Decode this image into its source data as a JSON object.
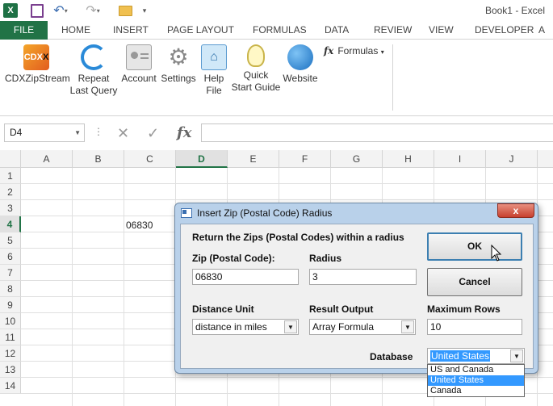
{
  "app": {
    "logo_letter": "X",
    "window_title": "Book1 - Excel"
  },
  "tabs": [
    "FILE",
    "HOME",
    "INSERT",
    "PAGE LAYOUT",
    "FORMULAS",
    "DATA",
    "REVIEW",
    "VIEW",
    "DEVELOPER",
    "A"
  ],
  "ribbon": {
    "buttons": [
      {
        "icon": "cdx-logo-icon",
        "label1": "CDXZipStream",
        "label2": ""
      },
      {
        "icon": "repeat-icon",
        "label1": "Repeat",
        "label2": "Last Query"
      },
      {
        "icon": "account-icon",
        "label1": "Account",
        "label2": ""
      },
      {
        "icon": "settings-icon",
        "label1": "Settings",
        "label2": ""
      },
      {
        "icon": "help-file-icon",
        "label1": "Help",
        "label2": "File"
      },
      {
        "icon": "lightbulb-icon",
        "label1": "Quick",
        "label2": "Start Guide"
      },
      {
        "icon": "globe-icon",
        "label1": "Website",
        "label2": ""
      }
    ],
    "cdx_logo_text": "CDX",
    "formulas_dropdown": "Formulas"
  },
  "formula_bar": {
    "name_box": "D4",
    "content": ""
  },
  "grid": {
    "columns": [
      "A",
      "B",
      "C",
      "D",
      "E",
      "F",
      "G",
      "H",
      "I",
      "J"
    ],
    "active_column": "D",
    "rows": [
      "1",
      "2",
      "3",
      "4",
      "5",
      "6",
      "7",
      "8",
      "9",
      "10",
      "11",
      "12",
      "13",
      "14"
    ],
    "active_row": "4",
    "cell_c4": "06830"
  },
  "dialog": {
    "title": "Insert Zip (Postal Code) Radius",
    "close_label": "x",
    "heading": "Return the Zips (Postal Codes) within a radius",
    "zip_label": "Zip (Postal Code):",
    "zip_value": "06830",
    "radius_label": "Radius",
    "radius_value": "3",
    "distance_unit_label": "Distance Unit",
    "distance_unit_value": "distance in miles",
    "result_output_label": "Result Output",
    "result_output_value": "Array Formula",
    "max_rows_label": "Maximum Rows",
    "max_rows_value": "10",
    "database_label": "Database",
    "database_value": "United States",
    "database_options": [
      "US and Canada",
      "United States",
      "Canada"
    ],
    "ok_label": "OK",
    "cancel_label": "Cancel"
  },
  "colors": {
    "excel_green": "#217346",
    "dialog_frame": "#b9d1ea",
    "selection_blue": "#3399ff"
  }
}
